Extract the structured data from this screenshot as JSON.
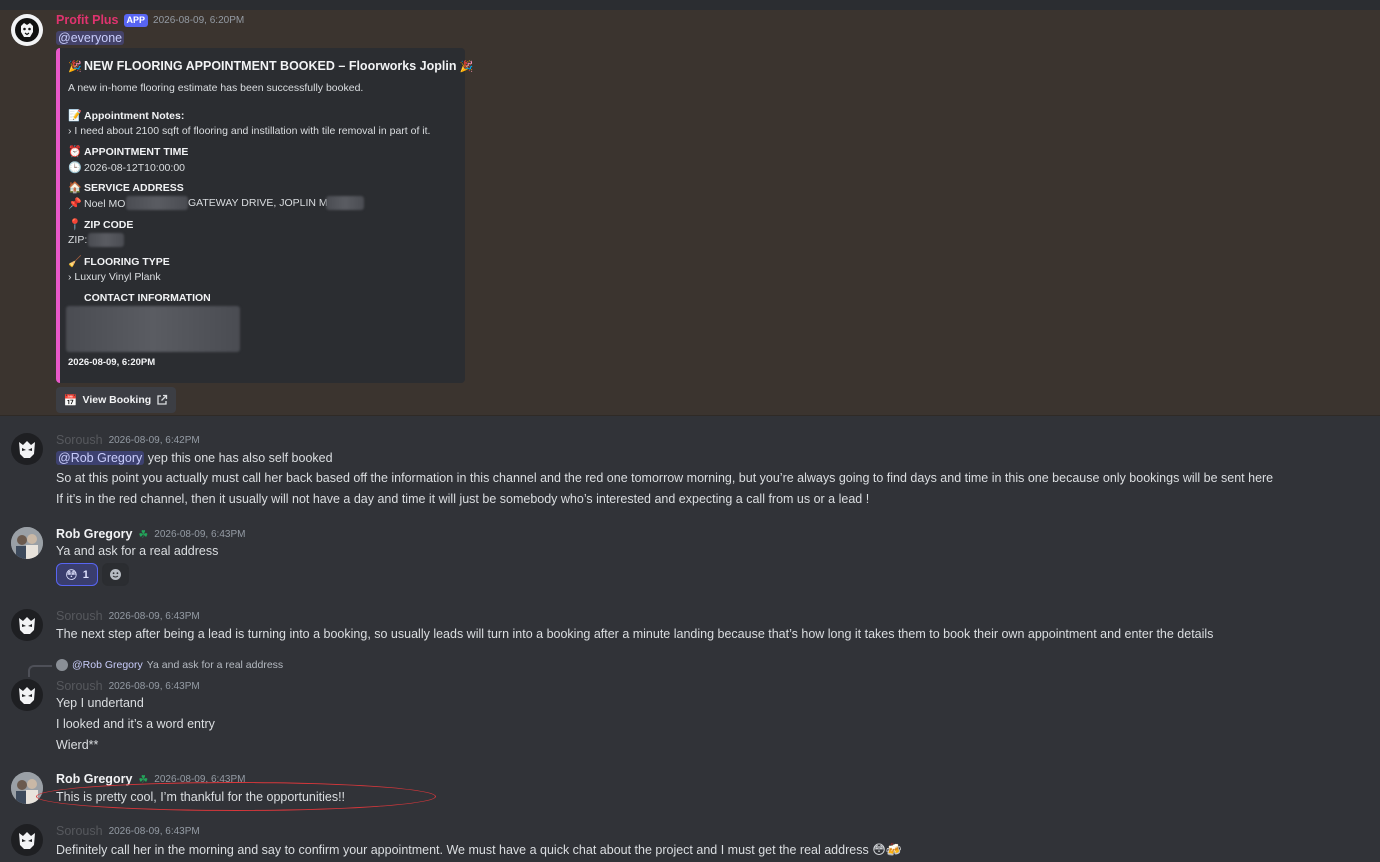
{
  "messages": {
    "m1": {
      "author": "Profit Plus",
      "tag": "APP",
      "timestamp": "2026-08-09, 6:20PM",
      "mention": "@everyone",
      "avatar_icon": "lion-icon"
    },
    "embed": {
      "title": "NEW FLOORING APPOINTMENT BOOKED – Floorworks Joplin",
      "description": "A new in-home flooring estimate has been successfully booked.",
      "notes_label": "Appointment Notes:",
      "notes_value": "› I need about 2100 sqft of flooring and instillation with tile removal in part of it.",
      "time_label": "APPOINTMENT TIME",
      "time_value": "2026-08-12T10:00:00",
      "address_label": "SERVICE ADDRESS",
      "address_name": "Noel MO",
      "address_street": "GATEWAY DRIVE, JOPLIN MO",
      "zip_label": "ZIP CODE",
      "zip_value": "ZIP:",
      "flooring_label": "FLOORING TYPE",
      "flooring_value": "› Luxury Vinyl Plank",
      "contact_label": "CONTACT INFORMATION",
      "footer_time": "2026-08-09, 6:20PM",
      "accent_color": "#e858c8"
    },
    "view_booking_label": "View Booking",
    "m2": {
      "author": "Soroush",
      "timestamp": "2026-08-09, 6:42PM",
      "mention": "@Rob Gregory",
      "line1_rest": " yep this one has also self booked",
      "line2": "So at this point you actually must call her back based off the information in this channel and the red one tomorrow morning, but you’re always going to find days and time in this one because only bookings will be sent here",
      "line3": "If it’s in the red channel, then it usually will not have a day and time it will just be somebody who’s interested and expecting a call from us or a lead !"
    },
    "m3": {
      "author": "Rob Gregory",
      "timestamp": "2026-08-09, 6:43PM",
      "text": "Ya and ask for a real address",
      "reaction_count": "1"
    },
    "m4": {
      "author": "Soroush",
      "timestamp": "2026-08-09, 6:43PM",
      "text": "The next step after being a lead is turning into a booking, so usually leads will turn into a booking after a minute landing because that’s how long it takes them to book their own appointment and enter the details"
    },
    "m5": {
      "reply_mention": "@Rob Gregory",
      "reply_text": "Ya and ask for a real address",
      "author": "Soroush",
      "timestamp": "2026-08-09, 6:43PM",
      "line1": "Yep I undertand",
      "line2": "I looked and it’s a word entry",
      "line3": "Wierd**"
    },
    "m6": {
      "author": "Rob Gregory",
      "timestamp": "2026-08-09, 6:43PM",
      "text": "This is pretty cool, I’m thankful for the opportunities!!"
    },
    "m7": {
      "author": "Soroush",
      "timestamp": "2026-08-09, 6:43PM",
      "text": "Definitely call her in the morning and say to confirm your appointment. We must have a quick chat about the project and I must get the real address"
    },
    "colors": {
      "background": "#313338",
      "highlight": "#3b342f",
      "mention": "#5865f2",
      "annotation_ellipse": "#d8373b"
    }
  }
}
